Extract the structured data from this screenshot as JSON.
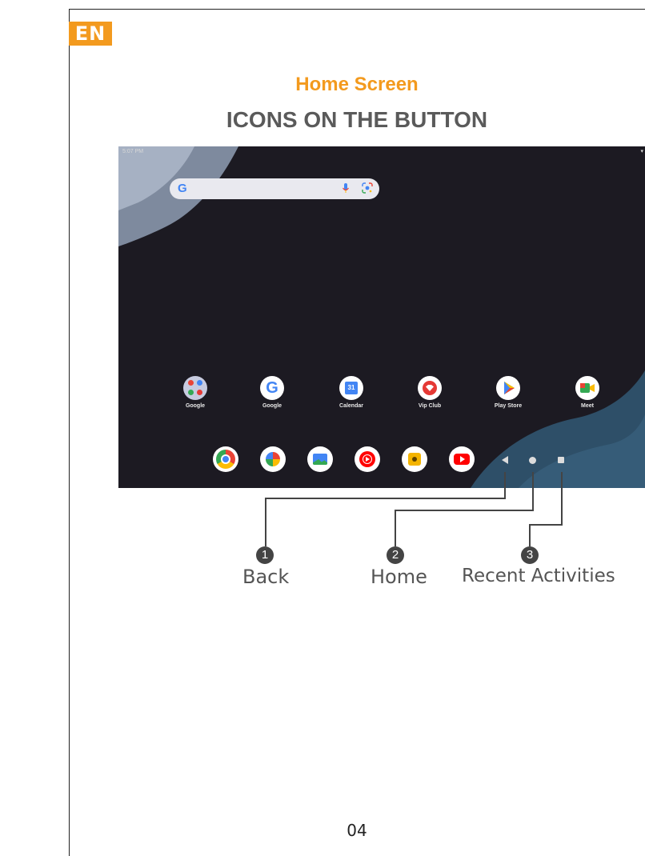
{
  "badge": "EN",
  "title": "Home Screen",
  "subtitle": "ICONS ON THE BUTTON",
  "screen": {
    "status_time": "5:07 PM",
    "apps": [
      {
        "label": "Google",
        "icon": "google-folder-icon"
      },
      {
        "label": "Google",
        "icon": "google-icon"
      },
      {
        "label": "Calendar",
        "icon": "calendar-icon"
      },
      {
        "label": "Vip Club",
        "icon": "vip-club-icon"
      },
      {
        "label": "Play Store",
        "icon": "play-store-icon"
      },
      {
        "label": "Meet",
        "icon": "meet-icon"
      }
    ],
    "dock": [
      "chrome-icon",
      "photos-icon",
      "files-icon",
      "youtube-music-icon",
      "camera-icon",
      "youtube-icon"
    ]
  },
  "callouts": [
    {
      "number": "1",
      "label": "Back"
    },
    {
      "number": "2",
      "label": "Home"
    },
    {
      "number": "3",
      "label": "Recent Activities"
    }
  ],
  "page_number": "04",
  "colors": {
    "accent": "#f39a1e",
    "heading_gray": "#5a5a5a",
    "callout_gray": "#555555"
  }
}
